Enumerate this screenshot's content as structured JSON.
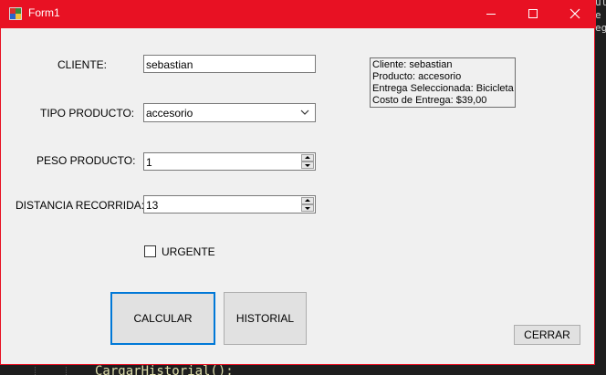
{
  "window": {
    "title": "Form1",
    "accent_color": "#e81123"
  },
  "form": {
    "cliente_label": "CLIENTE:",
    "cliente_value": "sebastian",
    "tipo_label": "TIPO PRODUCTO:",
    "tipo_value": "accesorio",
    "peso_label": "PESO PRODUCTO:",
    "peso_value": "1",
    "distancia_label": "DISTANCIA RECORRIDA:",
    "distancia_value": "13",
    "urgente_label": "URGENTE",
    "urgente_checked": false
  },
  "result": {
    "lines": [
      "Cliente: sebastian",
      "Producto: accesorio",
      "Entrega Seleccionada: Bicicleta",
      "Costo de Entrega: $39,00"
    ]
  },
  "buttons": {
    "calcular": "CALCULAR",
    "historial": "HISTORIAL",
    "cerrar": "CERRAR"
  },
  "editor": {
    "right_lines": [
      "ulL",
      "e",
      "eg"
    ],
    "bottom_code": "CargarHistorial();"
  }
}
